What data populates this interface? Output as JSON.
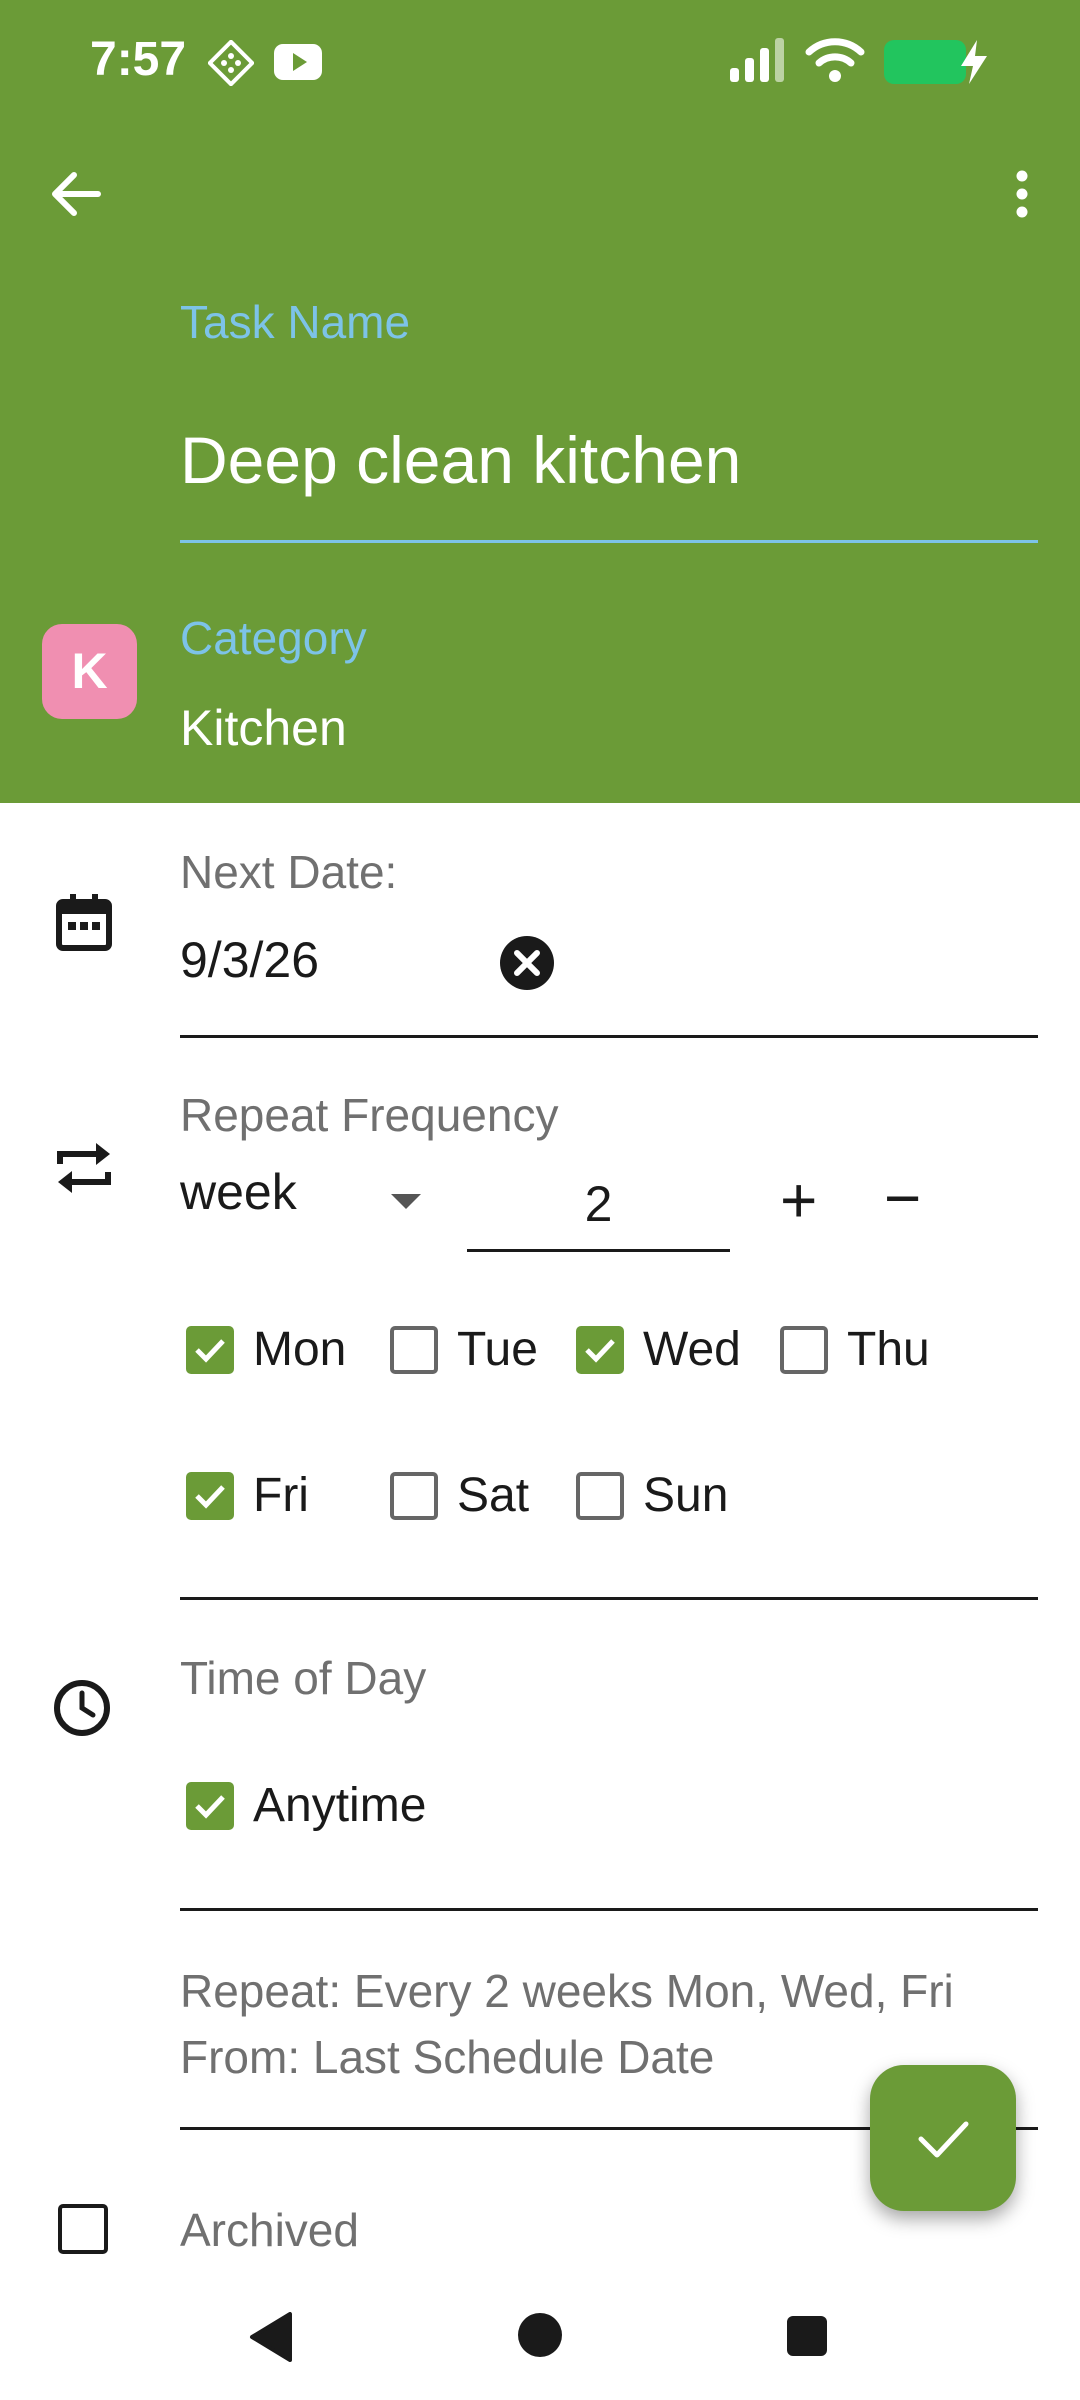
{
  "status_bar": {
    "time": "7:57",
    "icons": [
      "app-grid-icon",
      "youtube-icon",
      "signal-icon",
      "wifi-icon",
      "battery-icon",
      "charging-icon"
    ],
    "battery_color": "#22c55e"
  },
  "toolbar": {
    "back_icon": "arrow-left-icon",
    "menu_icon": "more-vertical-icon"
  },
  "task": {
    "label": "Task Name",
    "value": "Deep clean kitchen"
  },
  "category": {
    "avatar_letter": "K",
    "avatar_color": "#f08fb1",
    "label": "Category",
    "value": "Kitchen"
  },
  "next_date": {
    "label": "Next Date:",
    "value": "9/3/26",
    "clear_icon": "clear-circle-icon"
  },
  "repeat": {
    "label": "Repeat Frequency",
    "unit": "week",
    "interval": "2",
    "plus": "+",
    "minus": "−",
    "days": [
      {
        "label": "Mon",
        "checked": true
      },
      {
        "label": "Tue",
        "checked": false
      },
      {
        "label": "Wed",
        "checked": true
      },
      {
        "label": "Thu",
        "checked": false
      },
      {
        "label": "Fri",
        "checked": true
      },
      {
        "label": "Sat",
        "checked": false
      },
      {
        "label": "Sun",
        "checked": false
      }
    ]
  },
  "time_of_day": {
    "label": "Time of Day",
    "anytime_label": "Anytime",
    "anytime_checked": true
  },
  "summary": {
    "line1": "Repeat: Every 2 weeks Mon, Wed, Fri",
    "line2": "From: Last Schedule Date"
  },
  "archived": {
    "label": "Archived",
    "checked": false
  },
  "colors": {
    "primary": "#6b9b37",
    "accent": "#7dc3e8"
  }
}
